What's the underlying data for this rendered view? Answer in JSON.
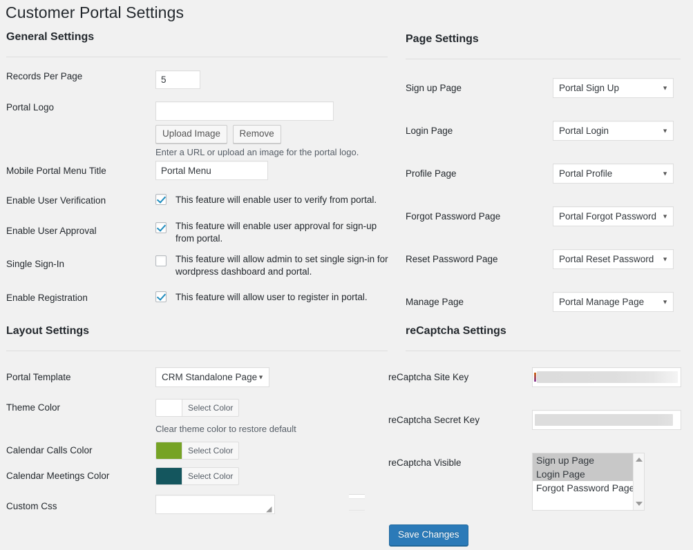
{
  "page": {
    "title": "Customer Portal Settings"
  },
  "general": {
    "heading": "General Settings",
    "records_per_page": {
      "label": "Records Per Page",
      "value": "5"
    },
    "portal_logo": {
      "label": "Portal Logo",
      "value": "",
      "placeholder": "",
      "upload_button": "Upload Image",
      "remove_button": "Remove",
      "hint": "Enter a URL or upload an image for the portal logo."
    },
    "mobile_menu_title": {
      "label": "Mobile Portal Menu Title",
      "value": "Portal Menu"
    },
    "user_verification": {
      "label": "Enable User Verification",
      "description": "This feature will enable user to verify from portal.",
      "checked": true
    },
    "user_approval": {
      "label": "Enable User Approval",
      "description": "This feature will enable user approval for sign-up from portal.",
      "checked": true
    },
    "single_sign_in": {
      "label": "Single Sign-In",
      "description": "This feature will allow admin to set single sign-in for wordpress dashboard and portal.",
      "checked": false
    },
    "registration": {
      "label": "Enable Registration",
      "description": "This feature will allow user to register in portal.",
      "checked": true
    }
  },
  "layout": {
    "heading": "Layout Settings",
    "portal_template": {
      "label": "Portal Template",
      "value": "CRM Standalone Page"
    },
    "theme_color": {
      "label": "Theme Color",
      "button": "Select Color",
      "swatch": "#ffffff",
      "hint": "Clear theme color to restore default"
    },
    "calendar_calls_color": {
      "label": "Calendar Calls Color",
      "button": "Select Color",
      "swatch": "#76a325"
    },
    "calendar_meetings_color": {
      "label": "Calendar Meetings Color",
      "button": "Select Color",
      "swatch": "#14565e"
    },
    "custom_css": {
      "label": "Custom Css",
      "value": ""
    }
  },
  "page_settings": {
    "heading": "Page Settings",
    "rows": [
      {
        "label": "Sign up Page",
        "value": "Portal Sign Up"
      },
      {
        "label": "Login Page",
        "value": "Portal Login"
      },
      {
        "label": "Profile Page",
        "value": "Portal Profile"
      },
      {
        "label": "Forgot Password Page",
        "value": "Portal Forgot Password"
      },
      {
        "label": "Reset Password Page",
        "value": "Portal Reset Password"
      },
      {
        "label": "Manage Page",
        "value": "Portal Manage Page"
      }
    ]
  },
  "recaptcha": {
    "heading": "reCaptcha Settings",
    "site_key": {
      "label": "reCaptcha Site Key",
      "value": ""
    },
    "secret_key": {
      "label": "reCaptcha Secret Key",
      "value": ""
    },
    "visible": {
      "label": "reCaptcha Visible",
      "options": [
        {
          "label": "Sign up Page",
          "selected": true
        },
        {
          "label": "Login Page",
          "selected": true
        },
        {
          "label": "Forgot Password Page",
          "selected": false
        }
      ]
    }
  },
  "footer": {
    "save_button": "Save Changes"
  },
  "colors": {
    "accent": "#2b7ab8",
    "background": "#f1f1f1",
    "rule": "#dddddd"
  }
}
